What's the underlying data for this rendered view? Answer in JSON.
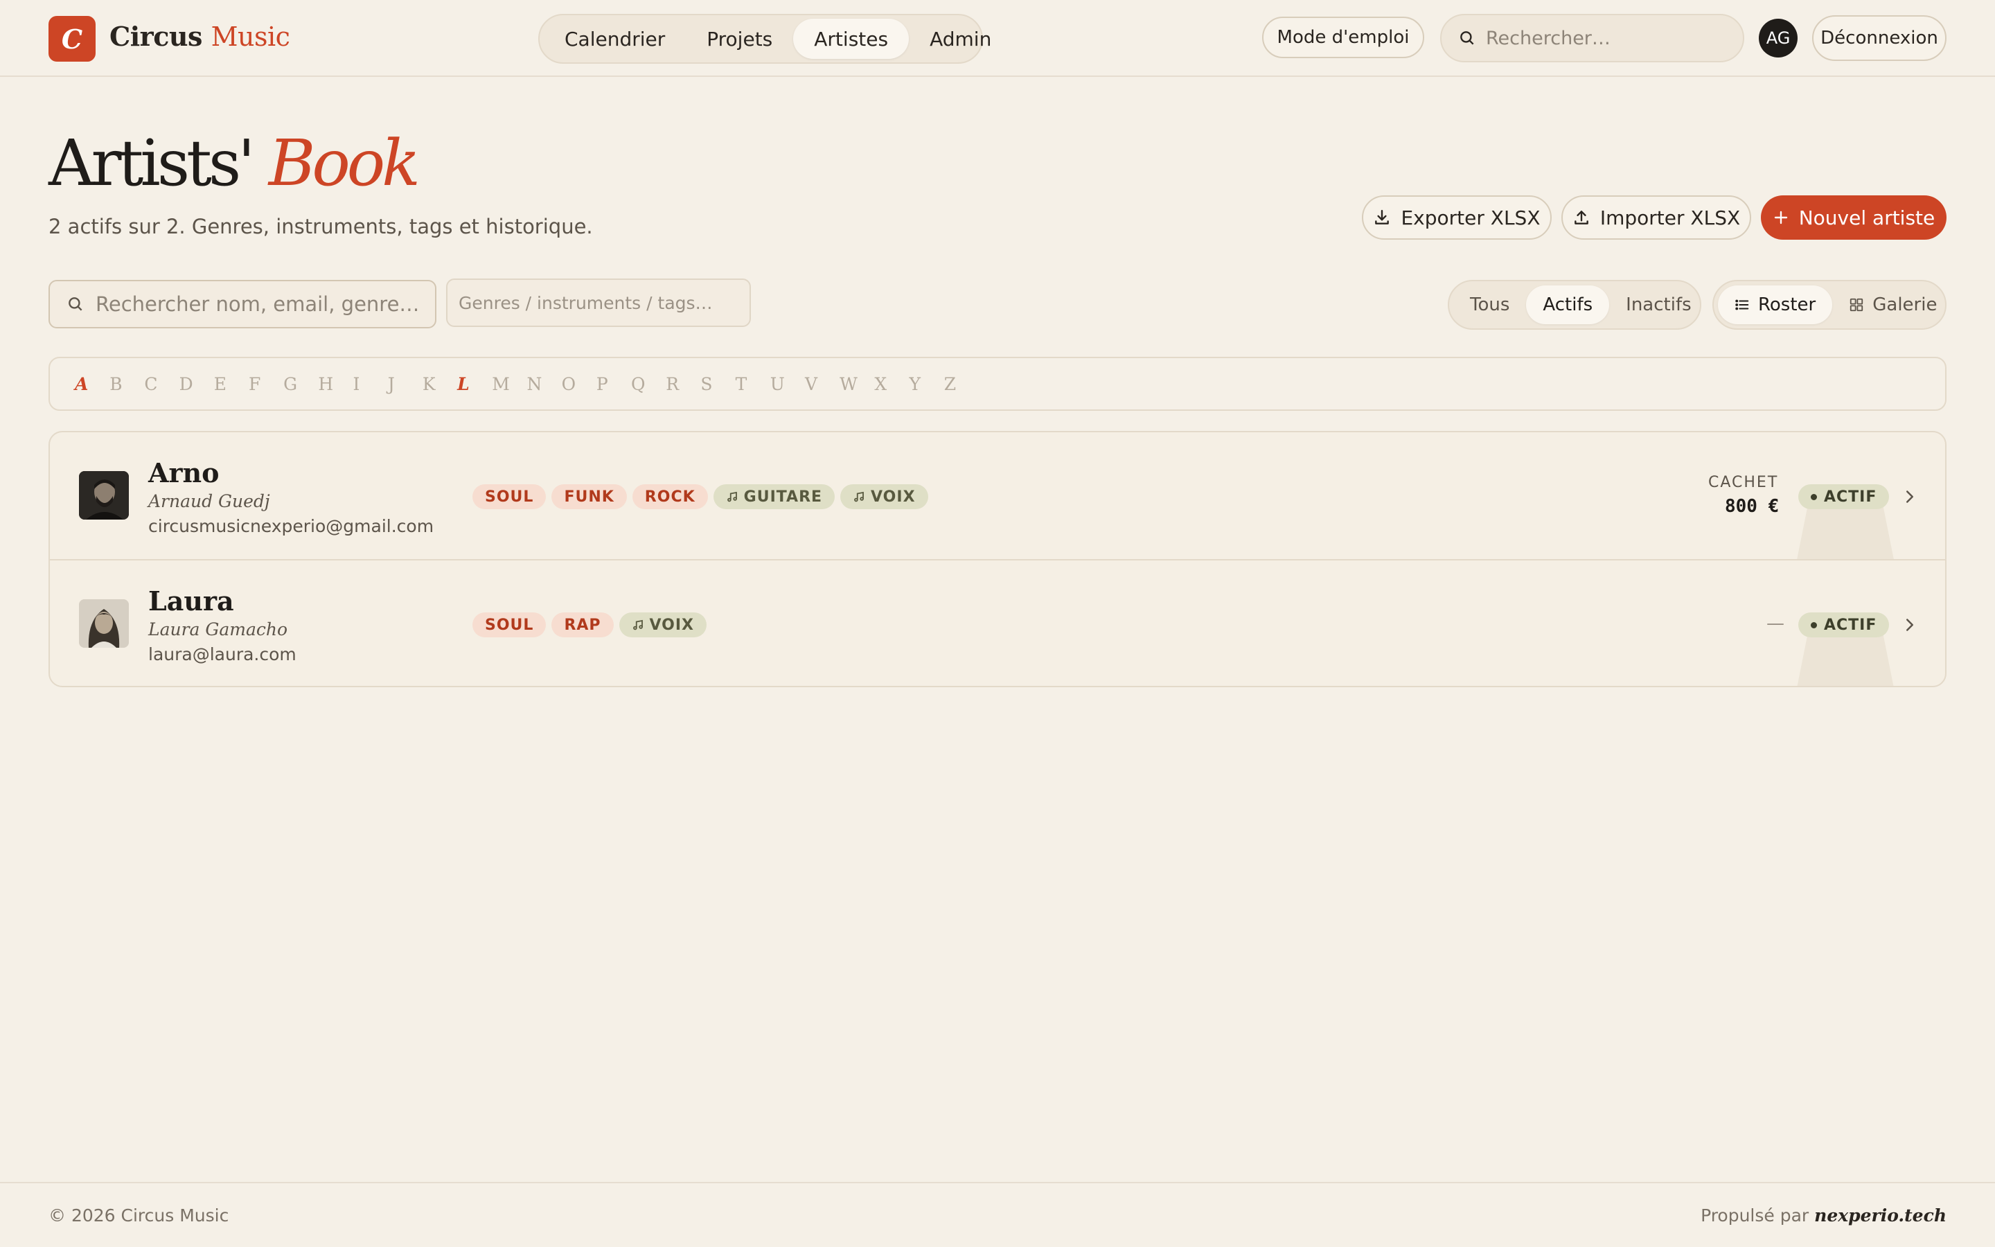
{
  "brand": {
    "logo_letter": "C",
    "name_part1": "Circus",
    "name_part2": "Music"
  },
  "nav": {
    "items": [
      {
        "label": "Calendrier",
        "active": false
      },
      {
        "label": "Projets",
        "active": false
      },
      {
        "label": "Artistes",
        "active": true
      },
      {
        "label": "Admin",
        "active": false
      }
    ]
  },
  "header": {
    "help_label": "Mode d'emploi",
    "search_placeholder": "Rechercher…",
    "avatar_initials": "AG",
    "logout_label": "Déconnexion"
  },
  "page": {
    "title_part1": "Artists'",
    "title_part2": "Book",
    "subtitle": "2 actifs sur 2. Genres, instruments, tags et historique.",
    "export_label": "Exporter XLSX",
    "import_label": "Importer XLSX",
    "new_label": "Nouvel artiste"
  },
  "filters": {
    "search_placeholder": "Rechercher nom, email, genre…",
    "tags_placeholder": "Genres / instruments / tags…",
    "status_options": [
      {
        "label": "Tous",
        "active": false
      },
      {
        "label": "Actifs",
        "active": true
      },
      {
        "label": "Inactifs",
        "active": false
      }
    ],
    "view_options": [
      {
        "label": "Roster",
        "icon": "list-icon",
        "active": true
      },
      {
        "label": "Galerie",
        "icon": "grid-icon",
        "active": false
      }
    ]
  },
  "alphabet": {
    "letters": [
      "A",
      "B",
      "C",
      "D",
      "E",
      "F",
      "G",
      "H",
      "I",
      "J",
      "K",
      "L",
      "M",
      "N",
      "O",
      "P",
      "Q",
      "R",
      "S",
      "T",
      "U",
      "V",
      "W",
      "X",
      "Y",
      "Z"
    ],
    "available": [
      "A",
      "L"
    ]
  },
  "artists": [
    {
      "name": "Arno",
      "real_name": "Arnaud Guedj",
      "email": "circusmusicnexperio@gmail.com",
      "genres": [
        "SOUL",
        "FUNK",
        "ROCK"
      ],
      "instruments": [
        "GUITARE",
        "VOIX"
      ],
      "cachet_label": "CACHET",
      "cachet_value": "800 €",
      "status": "ACTIF"
    },
    {
      "name": "Laura",
      "real_name": "Laura Gamacho",
      "email": "laura@laura.com",
      "genres": [
        "SOUL",
        "RAP"
      ],
      "instruments": [
        "VOIX"
      ],
      "cachet_label": "",
      "cachet_value": "—",
      "status": "ACTIF"
    }
  ],
  "footer": {
    "copyright": "© 2026 Circus Music",
    "powered_prefix": "Propulsé par",
    "powered_by": "nexperio.tech"
  },
  "colors": {
    "accent": "#cd4525",
    "background": "#f5f0e7",
    "genre_tag_bg": "#f7ddd0",
    "instrument_tag_bg": "#dfdfc6"
  }
}
